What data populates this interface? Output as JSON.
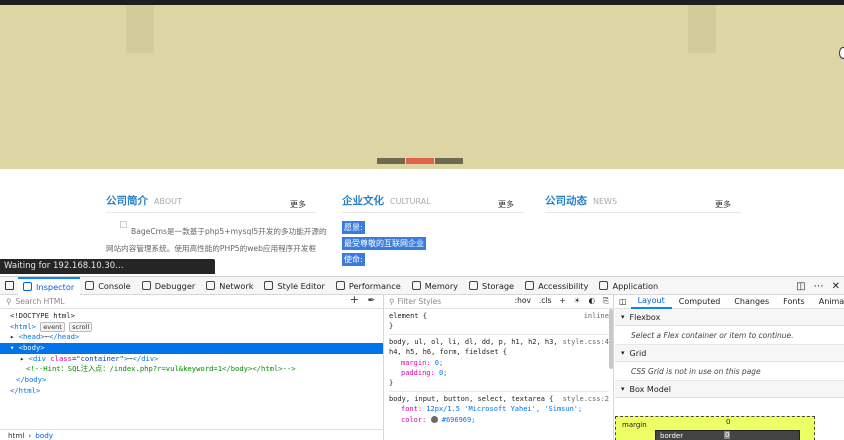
{
  "page": {
    "columns": [
      {
        "title": "公司简介",
        "sub": "ABOUT",
        "more": "更多"
      },
      {
        "title": "企业文化",
        "sub": "CULTURAL",
        "more": "更多"
      },
      {
        "title": "公司动态",
        "sub": "NEWS",
        "more": "更多"
      }
    ],
    "about_text": "BageCms是一款基于php5+mysql5开发的多功能开源的网站内容管理系统。使用高性能的PHP5的web应用程序开发框架，稳定、安全、高效、跨平台",
    "culture_items": [
      "愿景:",
      "最受尊敬的互联网企业",
      "使命:"
    ],
    "status": "Waiting for 192.168.10.30…"
  },
  "devtools": {
    "tabs": [
      "Inspector",
      "Console",
      "Debugger",
      "Network",
      "Style Editor",
      "Performance",
      "Memory",
      "Storage",
      "Accessibility",
      "Application"
    ],
    "search_placeholder": "Search HTML",
    "filter_placeholder": "Filter Styles",
    "filter_tools": [
      ":hov",
      ".cls"
    ],
    "tree": {
      "doctype": "<!DOCTYPE html>",
      "html_open": "<html>",
      "badge_event": "event",
      "badge_scroll": "scroll",
      "head": "<head>",
      "head_close": "</head>",
      "body_open": "<body>",
      "div_open": "<div ",
      "div_attr": "class",
      "div_val": "\"container\"",
      "div_close": "</div>",
      "comment": "<!--Hint：SQL注入点：/index.php?r=vul&keyword=1</body></html>-->",
      "body_close": "</body>",
      "html_close": "</html>"
    },
    "breadcrumb": [
      "html",
      "body"
    ],
    "rules": {
      "r1_selector": "element {",
      "r1_src": "inline",
      "r2_selector": "body, ul, ol, li, dl, dd, p, h1, h2, h3, h4, h5, h6, form, fieldset {",
      "r2_src": "style.css:4",
      "r2_p1": "margin",
      "r2_v1": "0;",
      "r2_p2": "padding",
      "r2_v2": "0;",
      "r3_selector": "body, input, button, select, textarea {",
      "r3_src": "style.css:2",
      "r3_p1": "font",
      "r3_v1": "12px/1.5 'Microsoft Yahei', 'Simsun';",
      "r3_p2": "color",
      "r3_v2": "#696969;",
      "close": "}"
    },
    "right_tabs": [
      "Layout",
      "Computed",
      "Changes",
      "Fonts",
      "Animat"
    ],
    "sections": {
      "flexbox": "Flexbox",
      "flexbox_msg": "Select a Flex container or item to continue.",
      "grid": "Grid",
      "grid_msg": "CSS Grid is not in use on this page",
      "box_model": "Box Model",
      "margin_label": "margin",
      "border_label": "border",
      "zero": "0"
    }
  },
  "colors": {
    "accent": "#0a84ff",
    "link": "#2a7fc9",
    "banner": "#ddd5a3",
    "slider_active": "#e0624a"
  }
}
